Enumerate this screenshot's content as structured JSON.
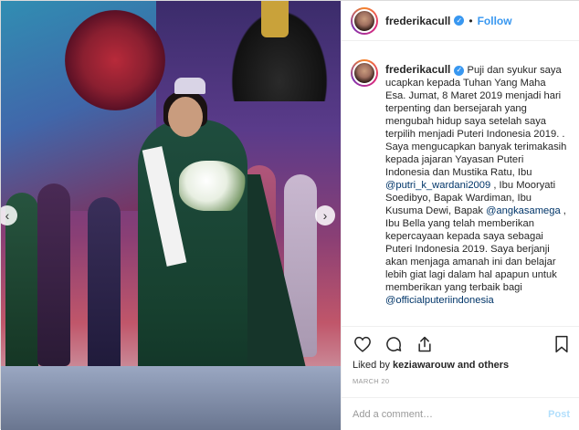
{
  "post": {
    "username": "frederikacull",
    "dot": "•",
    "follow_label": "Follow",
    "verified_icon": "verified-check-icon",
    "nav": {
      "prev": "‹",
      "next": "›"
    }
  },
  "caption": {
    "username": "frederikacull",
    "segments": [
      {
        "type": "text",
        "value": " Puji dan syukur saya ucapkan kepada Tuhan Yang Maha Esa. Jumat, 8 Maret 2019 menjadi hari terpenting dan bersejarah yang mengubah hidup saya setelah saya terpilih menjadi Puteri Indonesia 2019. ."
      },
      {
        "type": "break"
      },
      {
        "type": "text",
        "value": "Saya mengucapkan banyak terimakasih kepada jajaran Yayasan Puteri Indonesia dan Mustika Ratu, Ibu "
      },
      {
        "type": "mention",
        "value": "@putri_k_wardani2009"
      },
      {
        "type": "text",
        "value": " , Ibu Mooryati Soedibyo, Bapak Wardiman, Ibu Kusuma Dewi, Bapak "
      },
      {
        "type": "mention",
        "value": "@angkasamega"
      },
      {
        "type": "text",
        "value": " , Ibu Bella yang telah memberikan kepercayaan kepada saya sebagai Puteri Indonesia 2019. Saya berjanji akan menjaga amanah ini dan belajar lebih giat lagi dalam hal apapun untuk memberikan yang terbaik bagi "
      },
      {
        "type": "mention",
        "value": "@officialputeriindonesia"
      }
    ]
  },
  "actions": {
    "like_icon": "heart-icon",
    "comment_icon": "comment-icon",
    "share_icon": "share-icon",
    "save_icon": "bookmark-icon"
  },
  "likes": {
    "prefix": "Liked by ",
    "user": "keziawarouw",
    "suffix": " and others"
  },
  "date": "MARCH 20",
  "comment": {
    "placeholder": "Add a comment…",
    "post_label": "Post"
  }
}
